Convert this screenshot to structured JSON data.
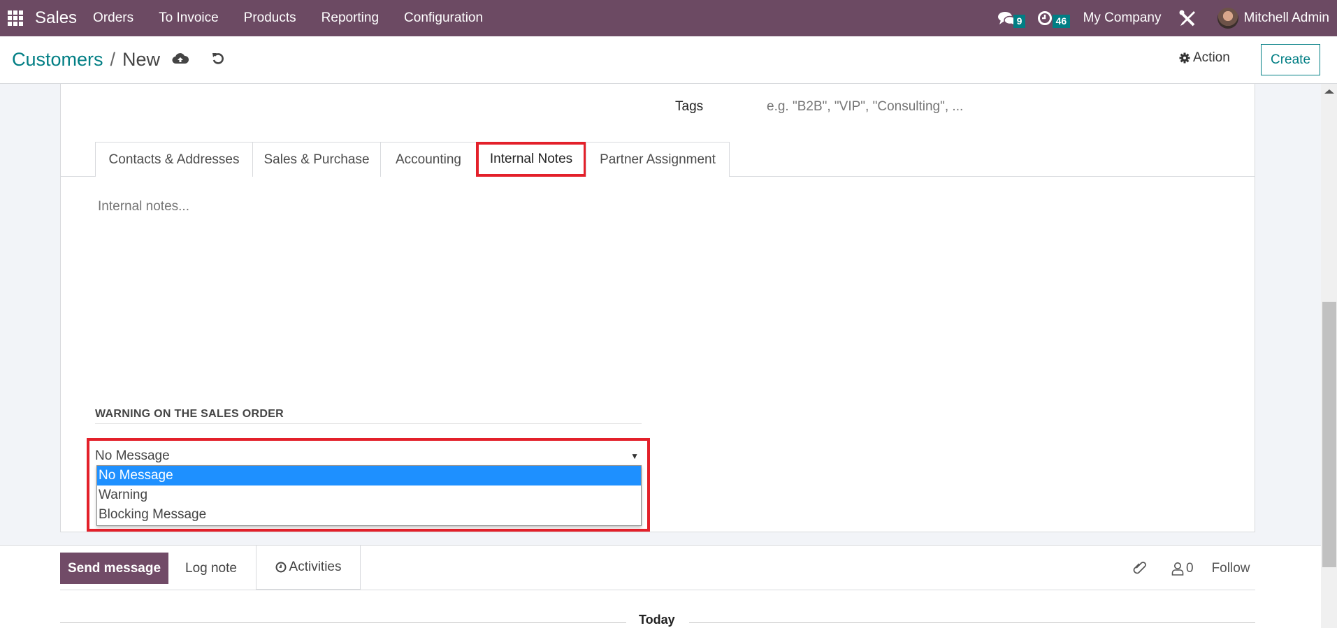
{
  "navbar": {
    "app_name": "Sales",
    "menu": [
      "Orders",
      "To Invoice",
      "Products",
      "Reporting",
      "Configuration"
    ],
    "messages_count": "9",
    "activities_count": "46",
    "company": "My Company",
    "user": "Mitchell Admin",
    "color": "#6c4a63",
    "badge_color": "#017e84"
  },
  "control_panel": {
    "breadcrumb_parent": "Customers",
    "breadcrumb_separator": "/",
    "breadcrumb_current": "New",
    "action_label": "Action",
    "create_label": "Create"
  },
  "form": {
    "tags_label": "Tags",
    "tags_placeholder": "e.g. \"B2B\", \"VIP\", \"Consulting\", ...",
    "tabs": [
      {
        "label": "Contacts & Addresses",
        "active": false
      },
      {
        "label": "Sales & Purchase",
        "active": false
      },
      {
        "label": "Accounting",
        "active": false
      },
      {
        "label": "Internal Notes",
        "active": true
      },
      {
        "label": "Partner Assignment",
        "active": false
      }
    ],
    "notes_placeholder": "Internal notes...",
    "warning_section_title": "WARNING ON THE SALES ORDER",
    "warning_select": {
      "value": "No Message",
      "options": [
        "No Message",
        "Warning",
        "Blocking Message"
      ],
      "highlighted": "No Message"
    },
    "highlight_color": "#e3202a"
  },
  "chatter": {
    "send_message": "Send message",
    "log_note": "Log note",
    "activities": "Activities",
    "followers_count": "0",
    "follow": "Follow",
    "date_separator": "Today"
  }
}
